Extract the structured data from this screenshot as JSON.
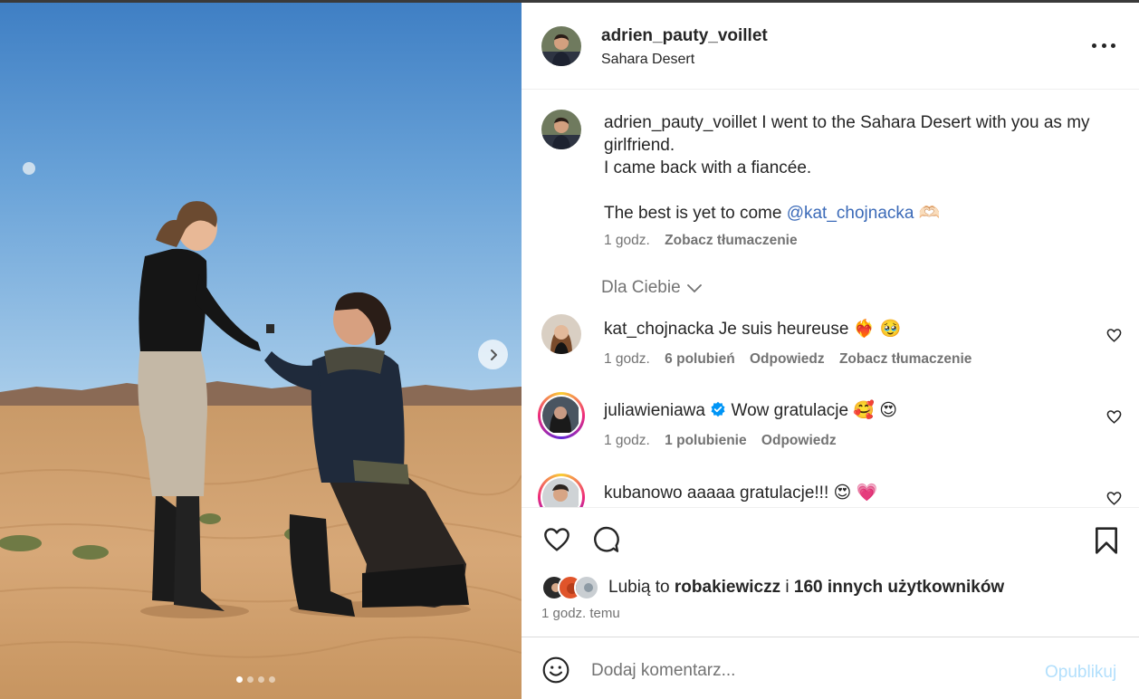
{
  "post": {
    "username": "adrien_pauty_voillet",
    "location": "Sahara Desert",
    "caption": {
      "username": "adrien_pauty_voillet",
      "line1": "I went to the Sahara Desert with you as my girlfriend.",
      "line2": "I came back with a fiancée.",
      "line3_prefix": "The best is yet to come",
      "mention": "@kat_chojnacka",
      "emoji": "🫶🏻",
      "time": "1 godz.",
      "translate": "Zobacz tłumaczenie"
    },
    "filter_label": "Dla Ciebie",
    "comments": [
      {
        "username": "kat_chojnacka",
        "text": "Je suis heureuse",
        "emoji": "❤️‍🔥 🥹",
        "time": "1 godz.",
        "likes": "6 polubień",
        "reply": "Odpowiedz",
        "translate": "Zobacz tłumaczenie"
      },
      {
        "username": "juliawieniawa",
        "verified": true,
        "text": "Wow gratulacje",
        "emoji": "🥰 😍",
        "time": "1 godz.",
        "likes": "1 polubienie",
        "reply": "Odpowiedz"
      },
      {
        "username": "kubanowo",
        "text": "aaaaa gratulacje!!!",
        "emoji": "😍 💗"
      }
    ],
    "likes": {
      "prefix": "Lubią to",
      "user": "robakiewiczz",
      "joiner": "i",
      "others": "160 innych użytkowników"
    },
    "time_ago": "1 godz. temu",
    "comment_placeholder": "Dodaj komentarz...",
    "publish_label": "Opublikuj",
    "carousel": {
      "total": 4,
      "active_index": 0
    },
    "colors": {
      "link": "#3b6ab8",
      "publish_disabled": "#b2dffc",
      "verified": "#0095f6"
    }
  }
}
